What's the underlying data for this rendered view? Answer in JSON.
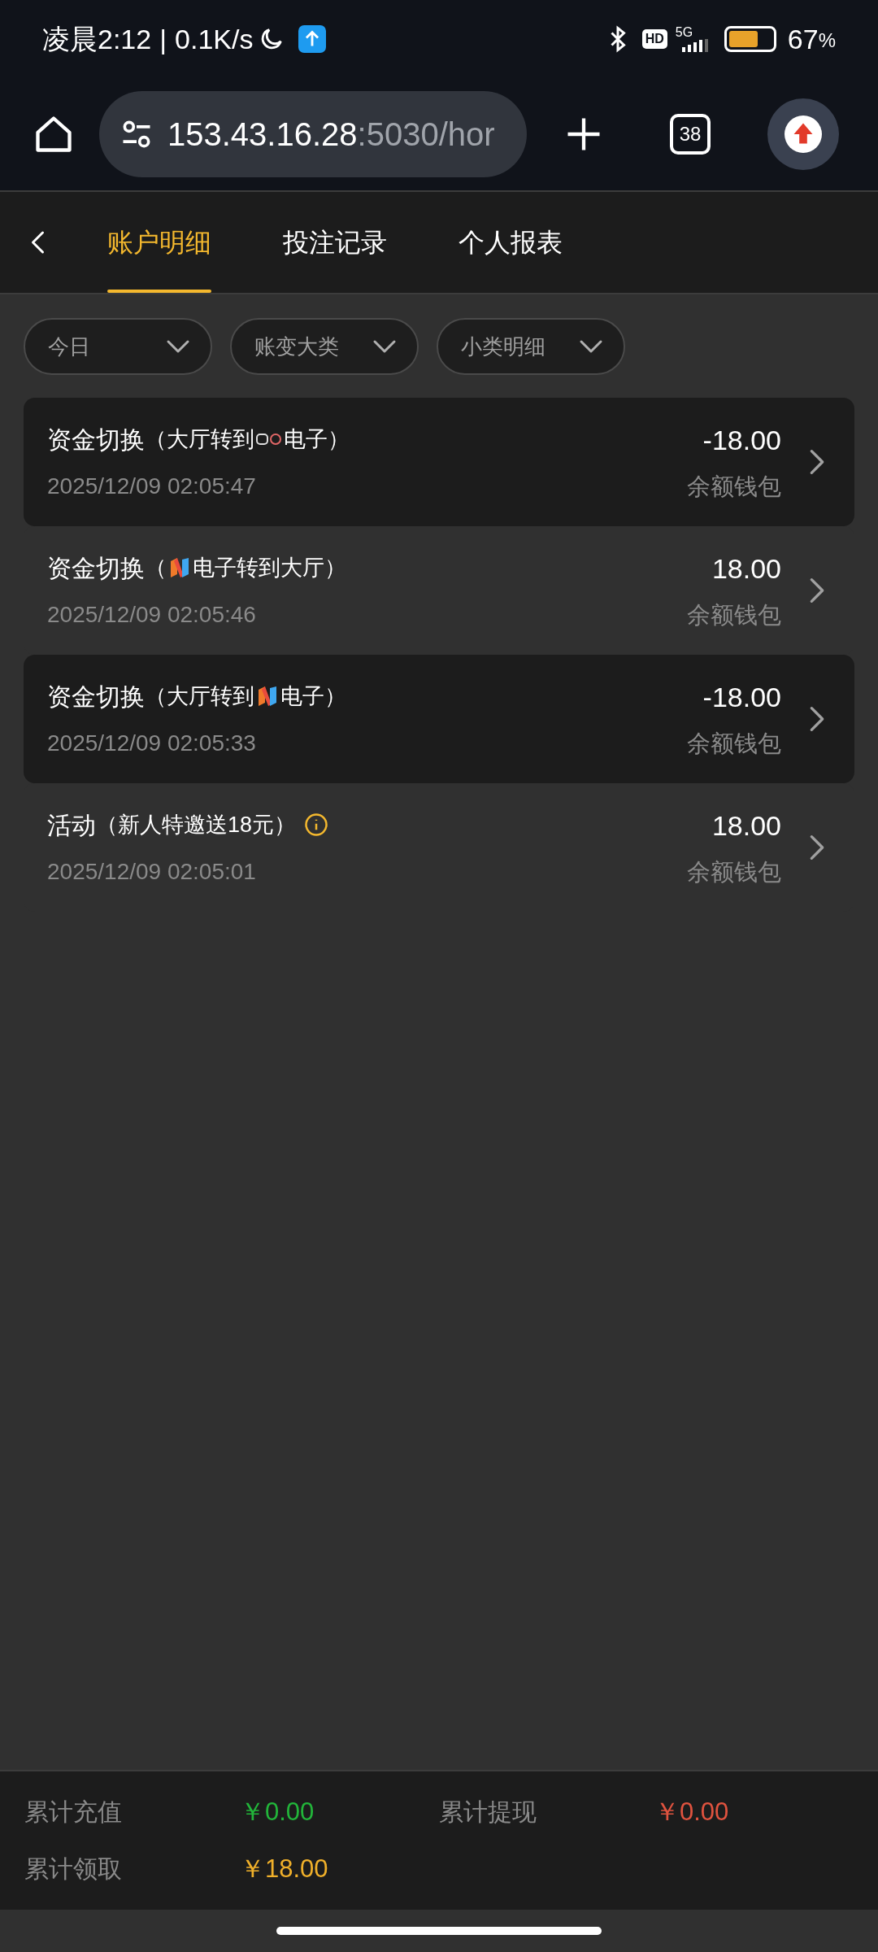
{
  "status_bar": {
    "time": "凌晨2:12",
    "separator": "|",
    "speed": "0.1K/s",
    "network": "5G",
    "hd": "HD",
    "battery": "67",
    "battery_unit": "%"
  },
  "browser": {
    "url": "153.43.16.28",
    "url_rest": ":5030/hor",
    "tab_count": "38"
  },
  "tabs": [
    {
      "label": "账户明细",
      "selected": true
    },
    {
      "label": "投注记录",
      "selected": false
    },
    {
      "label": "个人报表",
      "selected": false
    }
  ],
  "filters": [
    {
      "label": "今日"
    },
    {
      "label": "账变大类"
    },
    {
      "label": "小类明细"
    }
  ],
  "records": [
    {
      "title": "资金切换",
      "detail": [
        {
          "kind": "text",
          "text": "（大厅转到"
        },
        {
          "kind": "logo-pg"
        },
        {
          "kind": "text",
          "text": "电子）"
        }
      ],
      "time": "2025/12/09 02:05:47",
      "amount": "-18.00",
      "wallet": "余额钱包",
      "highlighted": true,
      "info": false
    },
    {
      "title": "资金切换",
      "detail": [
        {
          "kind": "text",
          "text": "（"
        },
        {
          "kind": "logo-n"
        },
        {
          "kind": "text",
          "text": "电子转到大厅）"
        }
      ],
      "time": "2025/12/09 02:05:46",
      "amount": "18.00",
      "wallet": "余额钱包",
      "highlighted": false,
      "info": false
    },
    {
      "title": "资金切换",
      "detail": [
        {
          "kind": "text",
          "text": "（大厅转到"
        },
        {
          "kind": "logo-n"
        },
        {
          "kind": "text",
          "text": "电子）"
        }
      ],
      "time": "2025/12/09 02:05:33",
      "amount": "-18.00",
      "wallet": "余额钱包",
      "highlighted": true,
      "info": false
    },
    {
      "title": "活动",
      "detail": [
        {
          "kind": "text",
          "text": "（新人特邀送18元）"
        }
      ],
      "time": "2025/12/09 02:05:01",
      "amount": "18.00",
      "wallet": "余额钱包",
      "highlighted": false,
      "info": true
    }
  ],
  "summary": [
    {
      "label": "累计充值",
      "value": "￥0.00",
      "color": "#22b53a"
    },
    {
      "label": "累计提现",
      "value": "￥0.00",
      "color": "#e0533f"
    },
    {
      "label": "累计领取",
      "value": "￥18.00",
      "color": "#f0b02a"
    }
  ]
}
